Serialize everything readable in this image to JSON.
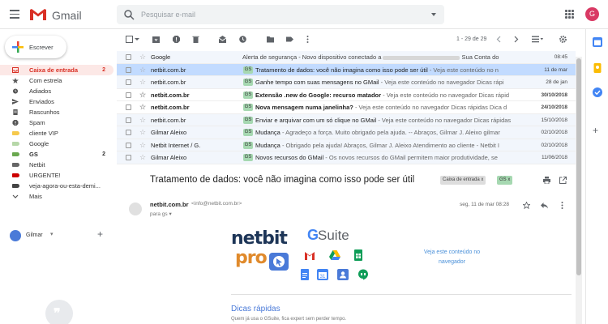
{
  "app": {
    "name": "Gmail",
    "avatar_letter": "G",
    "avatar_color": "#d93964"
  },
  "search": {
    "placeholder": "Pesquisar e-mail"
  },
  "compose": {
    "label": "Escrever"
  },
  "nav": [
    {
      "label": "Caixa de entrada",
      "count": "2",
      "icon": "inbox-icon",
      "active": true
    },
    {
      "label": "Com estrela",
      "count": "",
      "icon": "star-icon"
    },
    {
      "label": "Adiados",
      "count": "",
      "icon": "clock-icon"
    },
    {
      "label": "Enviados",
      "count": "",
      "icon": "send-icon"
    },
    {
      "label": "Rascunhos",
      "count": "",
      "icon": "draft-icon"
    },
    {
      "label": "Spam",
      "count": "",
      "icon": "spam-icon"
    },
    {
      "label": "cliente VIP",
      "count": "",
      "color": "#f6c94c"
    },
    {
      "label": "Google",
      "count": "",
      "color": "#b6d7a8"
    },
    {
      "label": "GS",
      "count": "2",
      "color": "#6aa84f",
      "bold": true
    },
    {
      "label": "Netbit",
      "count": "",
      "color": "#666666"
    },
    {
      "label": "URGENTE!",
      "count": "",
      "color": "#cc0000"
    },
    {
      "label": "veja-agora-ou-esta-demi...",
      "count": "",
      "color": "#444444"
    },
    {
      "label": "Mais",
      "count": "",
      "icon": "chevron-down-icon"
    }
  ],
  "user": {
    "name": "Gilmar"
  },
  "toolbar": {
    "pager": "1 - 29 de 29"
  },
  "emails": [
    {
      "sender": "Google",
      "label": "",
      "subject": "Alerta de segurança",
      "snippet": " - Novo dispositivo conectado a ",
      "snippet2": " Sua Conta do",
      "date": "08:45",
      "unread": false,
      "blurred": true
    },
    {
      "sender": "netbit.com.br",
      "label": "GS",
      "subject": "Tratamento de dados: você não imagina como isso pode ser útil",
      "snippet": " - Veja este conteúdo no n",
      "date": "11 de mar",
      "unread": false,
      "selected": true
    },
    {
      "sender": "netbit.com.br",
      "label": "GS",
      "subject": "Ganhe tempo com suas mensagens no GMail",
      "snippet": " - Veja este conteúdo no navegador Dicas rápi",
      "date": "28 de jan",
      "unread": false
    },
    {
      "sender": "netbit.com.br",
      "label": "GS",
      "subject": "Extensão .new do Google: recurso matador",
      "snippet": " - Veja este conteúdo no navegador Dicas rápid",
      "date": "30/10/2018",
      "unread": true
    },
    {
      "sender": "netbit.com.br",
      "label": "GS",
      "subject": "Nova mensagem numa janelinha?",
      "snippet": " - Veja este conteúdo no navegador Dicas rápidas Dica d",
      "date": "24/10/2018",
      "unread": true
    },
    {
      "sender": "netbit.com.br",
      "label": "GS",
      "subject": "Enviar e arquivar com um só clique no GMail",
      "snippet": " - Veja este conteúdo no navegador Dicas rápidas",
      "date": "15/10/2018",
      "unread": false
    },
    {
      "sender": "Gilmar Aleixo",
      "label": "GS",
      "subject": "Mudança",
      "snippet": " - Agradeço a força. Muito obrigado pela ajuda. -- Abraços, Gilmar J. Aleixo gilmar",
      "date": "02/10/2018",
      "unread": false
    },
    {
      "sender": "Netbit Internet / G.",
      "label": "GS",
      "subject": "Mudança",
      "snippet": " - Obrigado pela ajuda! Abraços, Gilmar J. Aleixo Atendimento ao cliente - Netbit I",
      "date": "02/10/2018",
      "unread": false
    },
    {
      "sender": "Gilmar Aleixo",
      "label": "GS",
      "subject": "Novos recursos do GMail",
      "snippet": " - Os novos recursos do GMail permitem maior produtividade, se",
      "date": "11/06/2018",
      "unread": false
    }
  ],
  "message": {
    "title": "Tratamento de dados: você não imagina como isso pode ser útil",
    "label_inbox": "Caixa de entrada x",
    "label_gs": "GS x",
    "sender_name": "netbit.com.br",
    "sender_email": "<info@netbit.com.br>",
    "to": "para gs",
    "date": "seg, 11 de mar 08:28",
    "brand_netbit": "netbit",
    "brand_pro": "pro",
    "gsuite_g": "G",
    "gsuite_text": "Suite",
    "view_link": "Veja este conteúdo no navegador",
    "tips_title": "Dicas rápidas",
    "tips_sub": "Quem já usa o GSuite, fica expert sem perder tempo."
  }
}
